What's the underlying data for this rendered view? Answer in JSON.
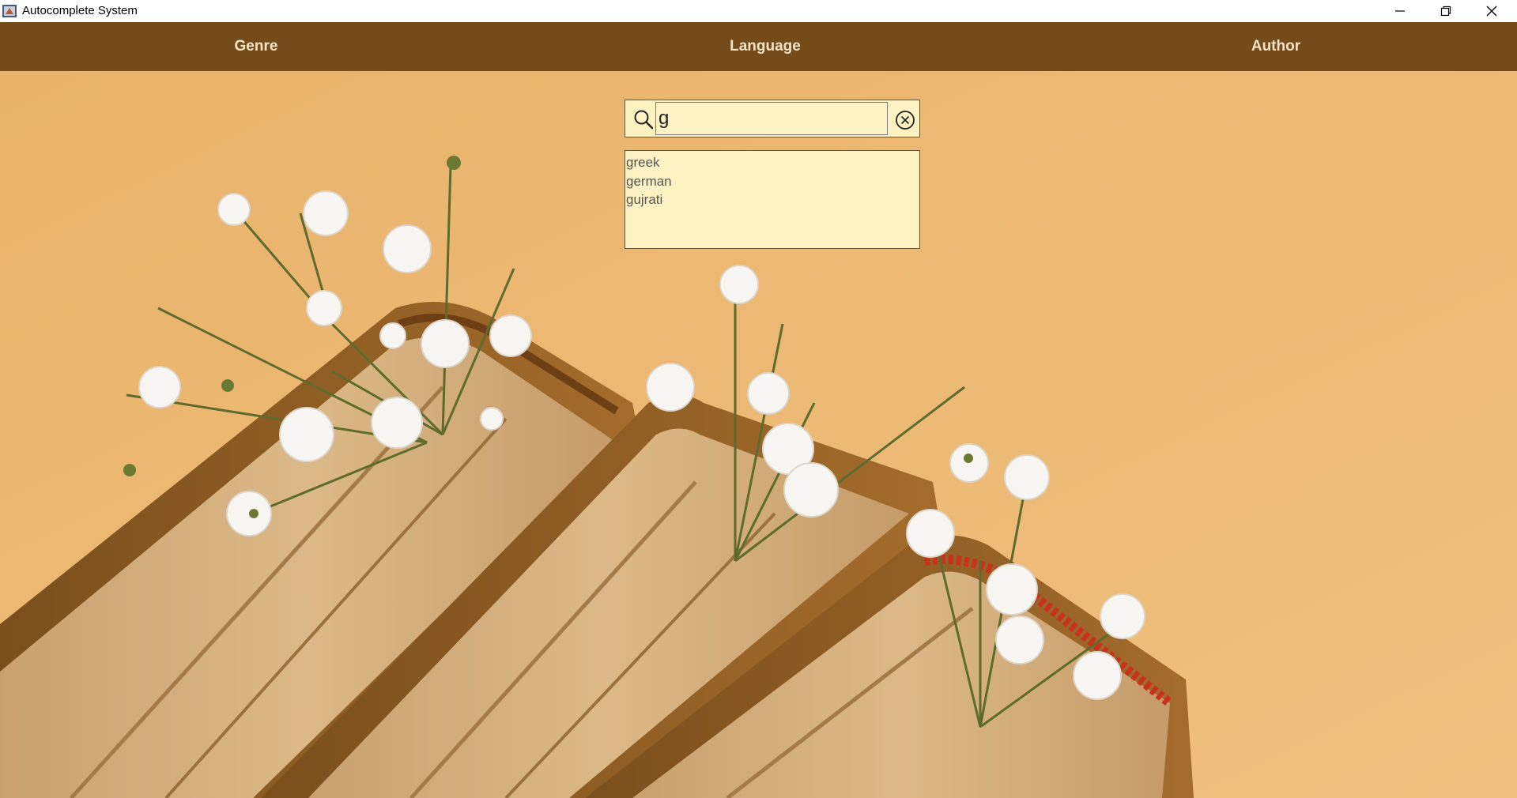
{
  "window": {
    "title": "Autocomplete System"
  },
  "navbar": {
    "items": [
      {
        "label": "Genre"
      },
      {
        "label": "Language"
      },
      {
        "label": "Author"
      }
    ]
  },
  "search": {
    "value": "g"
  },
  "suggestions": [
    "greek",
    "german",
    "gujrati"
  ],
  "colors": {
    "navbar_bg": "#744b19",
    "nav_text": "#f5e3c8",
    "background": "#ebb56f",
    "field_bg": "#fff2c2"
  },
  "icons": {
    "app": "java-app-icon",
    "search": "search-icon",
    "clear": "clear-circle-x-icon",
    "minimize": "minimize-icon",
    "maximize": "restore-icon",
    "close": "close-icon"
  }
}
